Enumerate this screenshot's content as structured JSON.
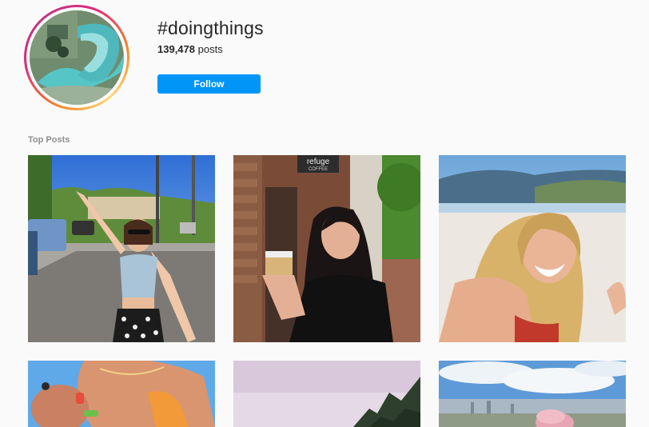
{
  "hashtag": {
    "title": "#doingthings",
    "post_count": "139,478",
    "post_count_suffix": "posts",
    "follow_label": "Follow"
  },
  "sections": {
    "top_posts_label": "Top Posts"
  },
  "coffee_sign": {
    "text_line1": "refuge",
    "text_line2": "COFFEE"
  },
  "colors": {
    "follow_blue": "#0095f6",
    "page_bg": "#fafafa",
    "muted_text": "#8e8e8e"
  }
}
